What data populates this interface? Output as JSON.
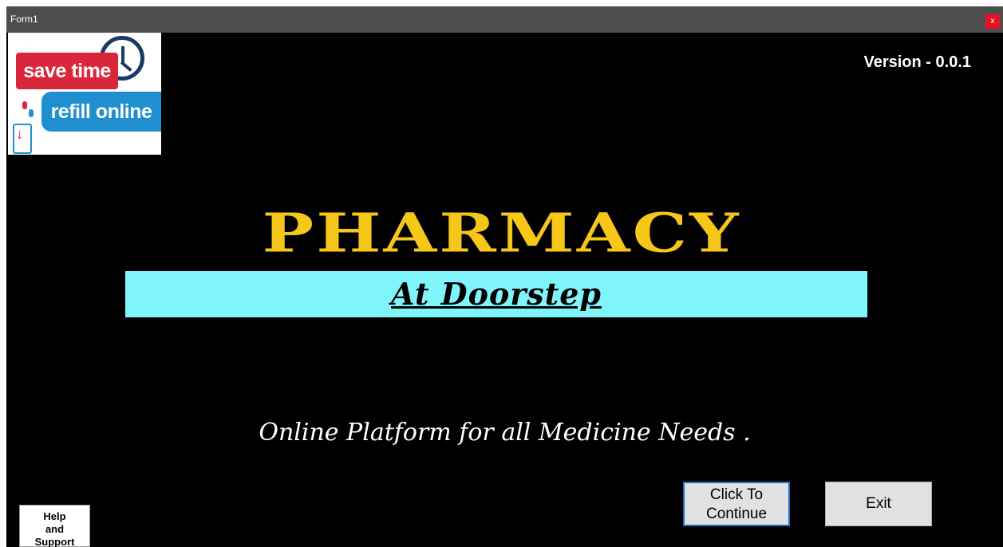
{
  "window": {
    "title": "Form1",
    "close_label": "x"
  },
  "logo": {
    "line1": "save time",
    "line2": "refill online",
    "icon": "clock-icon"
  },
  "version": "Version - 0.0.1",
  "brand": {
    "title": "PHARMACY",
    "subtitle": "At  Doorstep"
  },
  "tagline": "Online Platform for all Medicine Needs .",
  "buttons": {
    "continue": {
      "line1": "Click To",
      "line2": "Continue"
    },
    "exit": "Exit",
    "help": {
      "line1": "Help",
      "line2": "and",
      "line3": "Support"
    }
  },
  "colors": {
    "background": "#000000",
    "title_yellow": "#f6c619",
    "bar_cyan": "#7ff5fb",
    "accent_blue": "#1e6fc7"
  }
}
